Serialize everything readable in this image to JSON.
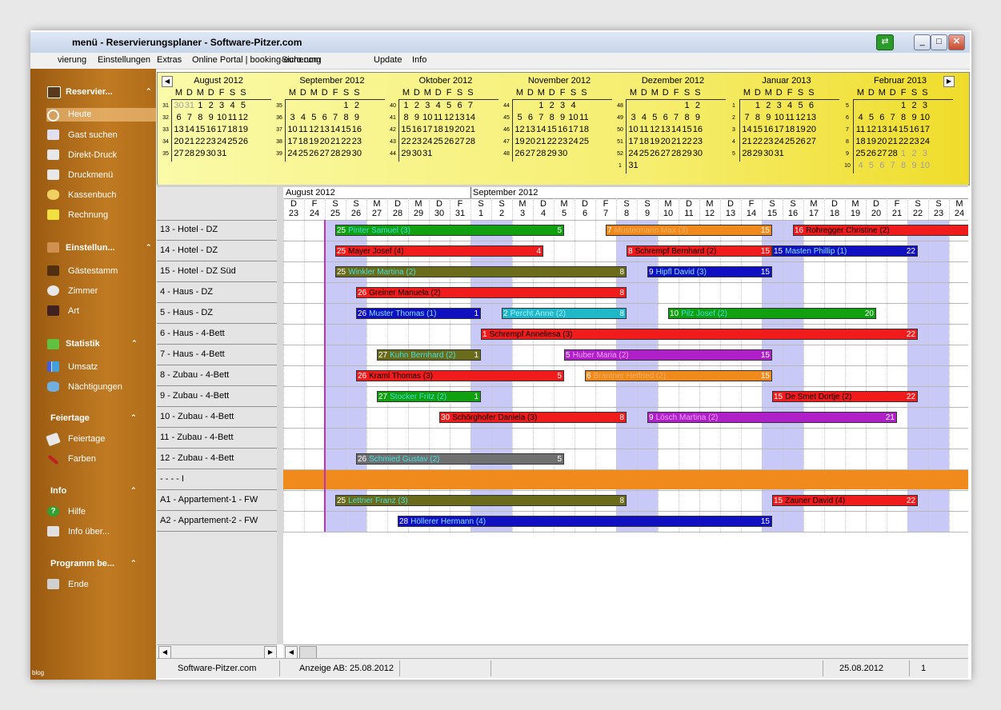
{
  "window": {
    "title": "menü - Reservierungsplaner - Software-Pitzer.com",
    "minimize": "_",
    "maximize": "□",
    "close": "✕"
  },
  "menu": [
    "vierung",
    "Einstellungen",
    "Extras",
    "Online Portal | booking-euro.com",
    "Sicherung",
    "Update",
    "Info"
  ],
  "sidebar": {
    "sections": [
      {
        "title": "Reservier...",
        "icon": "calendar-book-icon",
        "items": [
          {
            "label": "Heute",
            "icon": "no-entry-icon",
            "selected": true
          },
          {
            "label": "Gast suchen",
            "icon": "search-guest-icon"
          },
          {
            "label": "Direkt-Druck",
            "icon": "printer-icon"
          },
          {
            "label": "Druckmenü",
            "icon": "print-menu-icon"
          },
          {
            "label": "Kassenbuch",
            "icon": "cash-book-icon"
          },
          {
            "label": "Rechnung",
            "icon": "invoice-house-icon"
          }
        ]
      },
      {
        "title": "Einstellun...",
        "icon": "people-settings-icon",
        "items": [
          {
            "label": "Gästestamm",
            "icon": "guests-icon"
          },
          {
            "label": "Zimmer",
            "icon": "room-icon"
          },
          {
            "label": "Art",
            "icon": "type-icon"
          }
        ]
      },
      {
        "title": "Statistik",
        "icon": "statistics-icon",
        "items": [
          {
            "label": "Umsatz",
            "icon": "bar-chart-icon"
          },
          {
            "label": "Nächtigungen",
            "icon": "bed-icon"
          }
        ]
      },
      {
        "title": "Feiertage",
        "icon": "",
        "items": [
          {
            "label": "Feiertage",
            "icon": "holiday-icon"
          },
          {
            "label": "Farben",
            "icon": "paint-brush-icon"
          }
        ]
      },
      {
        "title": "Info",
        "icon": "",
        "items": [
          {
            "label": "Hilfe",
            "icon": "help-icon"
          },
          {
            "label": "Info über...",
            "icon": "info-about-icon"
          }
        ]
      },
      {
        "title": "Programm be...",
        "icon": "",
        "items": [
          {
            "label": "Ende",
            "icon": "exit-icon"
          }
        ]
      }
    ],
    "collapse_glyph": "⌃",
    "footer_text": "blog"
  },
  "year_calendar": {
    "day_headers": [
      "M",
      "D",
      "M",
      "D",
      "F",
      "S",
      "S"
    ],
    "months": [
      {
        "name": "August 2012",
        "weeks": [
          "31",
          "32",
          "33",
          "34",
          "35"
        ],
        "rows": [
          [
            "30",
            "31",
            "1",
            "2",
            "3",
            "4",
            "5"
          ],
          [
            "6",
            "7",
            "8",
            "9",
            "10",
            "11",
            "12"
          ],
          [
            "13",
            "14",
            "15",
            "16",
            "17",
            "18",
            "19"
          ],
          [
            "20",
            "21",
            "22",
            "23",
            "24",
            "25",
            "26"
          ],
          [
            "27",
            "28",
            "29",
            "30",
            "31",
            "",
            ""
          ]
        ]
      },
      {
        "name": "September 2012",
        "weeks": [
          "35",
          "36",
          "37",
          "38",
          "39"
        ],
        "rows": [
          [
            "",
            "",
            "",
            "",
            "",
            "1",
            "2"
          ],
          [
            "3",
            "4",
            "5",
            "6",
            "7",
            "8",
            "9"
          ],
          [
            "10",
            "11",
            "12",
            "13",
            "14",
            "15",
            "16"
          ],
          [
            "17",
            "18",
            "19",
            "20",
            "21",
            "22",
            "23"
          ],
          [
            "24",
            "25",
            "26",
            "27",
            "28",
            "29",
            "30"
          ]
        ]
      },
      {
        "name": "Oktober 2012",
        "weeks": [
          "40",
          "41",
          "42",
          "43",
          "44"
        ],
        "rows": [
          [
            "1",
            "2",
            "3",
            "4",
            "5",
            "6",
            "7"
          ],
          [
            "8",
            "9",
            "10",
            "11",
            "12",
            "13",
            "14"
          ],
          [
            "15",
            "16",
            "17",
            "18",
            "19",
            "20",
            "21"
          ],
          [
            "22",
            "23",
            "24",
            "25",
            "26",
            "27",
            "28"
          ],
          [
            "29",
            "30",
            "31",
            "",
            "",
            "",
            ""
          ]
        ]
      },
      {
        "name": "November 2012",
        "weeks": [
          "44",
          "45",
          "46",
          "47",
          "48"
        ],
        "rows": [
          [
            "",
            "",
            "1",
            "2",
            "3",
            "4",
            ""
          ],
          [
            "5",
            "6",
            "7",
            "8",
            "9",
            "10",
            "11"
          ],
          [
            "12",
            "13",
            "14",
            "15",
            "16",
            "17",
            "18"
          ],
          [
            "19",
            "20",
            "21",
            "22",
            "23",
            "24",
            "25"
          ],
          [
            "26",
            "27",
            "28",
            "29",
            "30",
            "",
            ""
          ]
        ]
      },
      {
        "name": "Dezember 2012",
        "weeks": [
          "48",
          "49",
          "50",
          "51",
          "52",
          "1"
        ],
        "rows": [
          [
            "",
            "",
            "",
            "",
            "",
            "1",
            "2"
          ],
          [
            "3",
            "4",
            "5",
            "6",
            "7",
            "8",
            "9"
          ],
          [
            "10",
            "11",
            "12",
            "13",
            "14",
            "15",
            "16"
          ],
          [
            "17",
            "18",
            "19",
            "20",
            "21",
            "22",
            "23"
          ],
          [
            "24",
            "25",
            "26",
            "27",
            "28",
            "29",
            "30"
          ],
          [
            "31",
            "",
            "",
            "",
            "",
            "",
            ""
          ]
        ]
      },
      {
        "name": "Januar 2013",
        "weeks": [
          "1",
          "2",
          "3",
          "4",
          "5"
        ],
        "rows": [
          [
            "",
            "1",
            "2",
            "3",
            "4",
            "5",
            "6"
          ],
          [
            "7",
            "8",
            "9",
            "10",
            "11",
            "12",
            "13"
          ],
          [
            "14",
            "15",
            "16",
            "17",
            "18",
            "19",
            "20"
          ],
          [
            "21",
            "22",
            "23",
            "24",
            "25",
            "26",
            "27"
          ],
          [
            "28",
            "29",
            "30",
            "31",
            "",
            "",
            ""
          ]
        ]
      },
      {
        "name": "Februar 2013",
        "weeks": [
          "5",
          "6",
          "7",
          "8",
          "9",
          "10"
        ],
        "rows": [
          [
            "",
            "",
            "",
            "",
            "1",
            "2",
            "3"
          ],
          [
            "4",
            "5",
            "6",
            "7",
            "8",
            "9",
            "10"
          ],
          [
            "11",
            "12",
            "13",
            "14",
            "15",
            "16",
            "17"
          ],
          [
            "18",
            "19",
            "20",
            "21",
            "22",
            "23",
            "24"
          ],
          [
            "25",
            "26",
            "27",
            "28",
            "1",
            "2",
            "3"
          ],
          [
            "4",
            "5",
            "6",
            "7",
            "8",
            "9",
            "10"
          ]
        ]
      }
    ],
    "nav_prev": "◀",
    "nav_next": "▶"
  },
  "planner": {
    "month_labels": [
      "August 2012",
      "September 2012"
    ],
    "days": [
      {
        "w": "D",
        "d": "23"
      },
      {
        "w": "F",
        "d": "24"
      },
      {
        "w": "S",
        "d": "25"
      },
      {
        "w": "S",
        "d": "26"
      },
      {
        "w": "M",
        "d": "27"
      },
      {
        "w": "D",
        "d": "28"
      },
      {
        "w": "M",
        "d": "29"
      },
      {
        "w": "D",
        "d": "30"
      },
      {
        "w": "F",
        "d": "31"
      },
      {
        "w": "S",
        "d": "1"
      },
      {
        "w": "S",
        "d": "2"
      },
      {
        "w": "M",
        "d": "3"
      },
      {
        "w": "D",
        "d": "4"
      },
      {
        "w": "M",
        "d": "5"
      },
      {
        "w": "D",
        "d": "6"
      },
      {
        "w": "F",
        "d": "7"
      },
      {
        "w": "S",
        "d": "8"
      },
      {
        "w": "S",
        "d": "9"
      },
      {
        "w": "M",
        "d": "10"
      },
      {
        "w": "D",
        "d": "11"
      },
      {
        "w": "M",
        "d": "12"
      },
      {
        "w": "D",
        "d": "13"
      },
      {
        "w": "F",
        "d": "14"
      },
      {
        "w": "S",
        "d": "15"
      },
      {
        "w": "S",
        "d": "16"
      },
      {
        "w": "M",
        "d": "17"
      },
      {
        "w": "D",
        "d": "18"
      },
      {
        "w": "M",
        "d": "19"
      },
      {
        "w": "D",
        "d": "20"
      },
      {
        "w": "F",
        "d": "21"
      },
      {
        "w": "S",
        "d": "22"
      },
      {
        "w": "S",
        "d": "23"
      },
      {
        "w": "M",
        "d": "24"
      }
    ],
    "weekend_color": "#c9c9f7",
    "today_line_color": "#c030c0",
    "rooms": [
      "13 - Hotel - DZ",
      "14 - Hotel - DZ",
      "15 - Hotel - DZ Süd",
      "4 - Haus - DZ",
      "5 - Haus - DZ",
      "6 - Haus - 4-Bett",
      "7 - Haus - 4-Bett",
      "8 - Zubau - 4-Bett",
      "9 - Zubau - 4-Bett",
      "10 - Zubau - 4-Bett",
      "11 - Zubau - 4-Bett",
      "12 - Zubau - 4-Bett",
      "- - - - I",
      "A1 - Appartement-1 - FW",
      "A2 - Appartement-2 - FW"
    ],
    "bookings": [
      {
        "row": 0,
        "from": 2.5,
        "to": 13.5,
        "start": "25",
        "end": "5",
        "name": "Pinter Samuel (3)",
        "color": "#10a010",
        "text": "#40e0e0"
      },
      {
        "row": 0,
        "from": 15.5,
        "to": 23.5,
        "start": "7",
        "end": "15",
        "name": "Mustermann Max (3)",
        "color": "#f08a1c",
        "text": "#f0b060"
      },
      {
        "row": 0,
        "from": 24.5,
        "to": 33,
        "start": "16",
        "end": "",
        "name": "Rohregger Christine (2)",
        "color": "#f01c1c",
        "text": "#000000"
      },
      {
        "row": 1,
        "from": 2.5,
        "to": 12.5,
        "start": "25",
        "end": "4",
        "name": "Mayer  Josef (4)",
        "color": "#f01c1c",
        "text": "#000000"
      },
      {
        "row": 1,
        "from": 16.5,
        "to": 23.5,
        "start": "8",
        "end": "15",
        "name": "Schrempf Bernhard (2)",
        "color": "#f01c1c",
        "text": "#000000"
      },
      {
        "row": 1,
        "from": 23.5,
        "to": 30.5,
        "start": "15",
        "end": "22",
        "name": "Masten Phillip (1)",
        "color": "#1010c0",
        "text": "#80e0ff"
      },
      {
        "row": 2,
        "from": 2.5,
        "to": 16.5,
        "start": "25",
        "end": "8",
        "name": "Winkler Martina (2)",
        "color": "#6b6b1c",
        "text": "#40e0e0"
      },
      {
        "row": 2,
        "from": 17.5,
        "to": 23.5,
        "start": "9",
        "end": "15",
        "name": "Hipfl David (3)",
        "color": "#1010c0",
        "text": "#80e0ff"
      },
      {
        "row": 3,
        "from": 3.5,
        "to": 16.5,
        "start": "26",
        "end": "8",
        "name": "Greiner Manuela (2)",
        "color": "#f01c1c",
        "text": "#000000"
      },
      {
        "row": 4,
        "from": 3.5,
        "to": 9.5,
        "start": "26",
        "end": "1",
        "name": "Muster Thomas (1)",
        "color": "#1010c0",
        "text": "#80e0ff"
      },
      {
        "row": 4,
        "from": 10.5,
        "to": 16.5,
        "start": "2",
        "end": "8",
        "name": "Percht Anne (2)",
        "color": "#20b8c8",
        "text": "#a0f0ff"
      },
      {
        "row": 4,
        "from": 18.5,
        "to": 28.5,
        "start": "10",
        "end": "20",
        "name": "Pilz Josef (2)",
        "color": "#10a010",
        "text": "#40e0e0"
      },
      {
        "row": 5,
        "from": 9.5,
        "to": 30.5,
        "start": "1",
        "end": "22",
        "name": "Schrempf Anneliesa (3)",
        "color": "#f01c1c",
        "text": "#000000"
      },
      {
        "row": 6,
        "from": 4.5,
        "to": 9.5,
        "start": "27",
        "end": "1",
        "name": "Kuhn Bernhard (2)",
        "color": "#6b6b1c",
        "text": "#40e0e0"
      },
      {
        "row": 6,
        "from": 13.5,
        "to": 23.5,
        "start": "5",
        "end": "15",
        "name": "Huber Maria (2)",
        "color": "#b020c8",
        "text": "#f0a0ff"
      },
      {
        "row": 7,
        "from": 3.5,
        "to": 13.5,
        "start": "26",
        "end": "5",
        "name": "Kraml Thomas (3)",
        "color": "#f01c1c",
        "text": "#000000"
      },
      {
        "row": 7,
        "from": 14.5,
        "to": 23.5,
        "start": "6",
        "end": "15",
        "name": "Brantner Helfried (2)",
        "color": "#f08a1c",
        "text": "#f0b060"
      },
      {
        "row": 8,
        "from": 4.5,
        "to": 9.5,
        "start": "27",
        "end": "1",
        "name": "Stocker Fritz (2)",
        "color": "#10a010",
        "text": "#40e0e0"
      },
      {
        "row": 8,
        "from": 23.5,
        "to": 30.5,
        "start": "15",
        "end": "22",
        "name": "De Smet Dortje (2)",
        "color": "#f01c1c",
        "text": "#000000"
      },
      {
        "row": 9,
        "from": 7.5,
        "to": 16.5,
        "start": "30",
        "end": "8",
        "name": "Schörghofer Daniela (3)",
        "color": "#f01c1c",
        "text": "#000000"
      },
      {
        "row": 9,
        "from": 17.5,
        "to": 29.5,
        "start": "9",
        "end": "21",
        "name": "Lösch Martina (2)",
        "color": "#b020c8",
        "text": "#f0a0ff"
      },
      {
        "row": 11,
        "from": 3.5,
        "to": 13.5,
        "start": "26",
        "end": "5",
        "name": "Schmied Gustav (2)",
        "color": "#707070",
        "text": "#40e0e0"
      },
      {
        "row": 13,
        "from": 2.5,
        "to": 16.5,
        "start": "25",
        "end": "8",
        "name": "Lettner Franz (3)",
        "color": "#6b6b1c",
        "text": "#40e0e0"
      },
      {
        "row": 13,
        "from": 23.5,
        "to": 30.5,
        "start": "15",
        "end": "22",
        "name": "Zauner David (4)",
        "color": "#f01c1c",
        "text": "#000000"
      },
      {
        "row": 14,
        "from": 5.5,
        "to": 23.5,
        "start": "28",
        "end": "15",
        "name": "Höllerer Hermann (4)",
        "color": "#1010c0",
        "text": "#80e0ff"
      }
    ],
    "blocked_row": {
      "row": 12,
      "color": "#f08a1c"
    }
  },
  "statusbar": {
    "app": "Software-Pitzer.com",
    "display_from": "Anzeige AB: 25.08.2012",
    "date": "25.08.2012",
    "extra": "1"
  },
  "scroll": {
    "left": "◀",
    "right": "▶"
  }
}
